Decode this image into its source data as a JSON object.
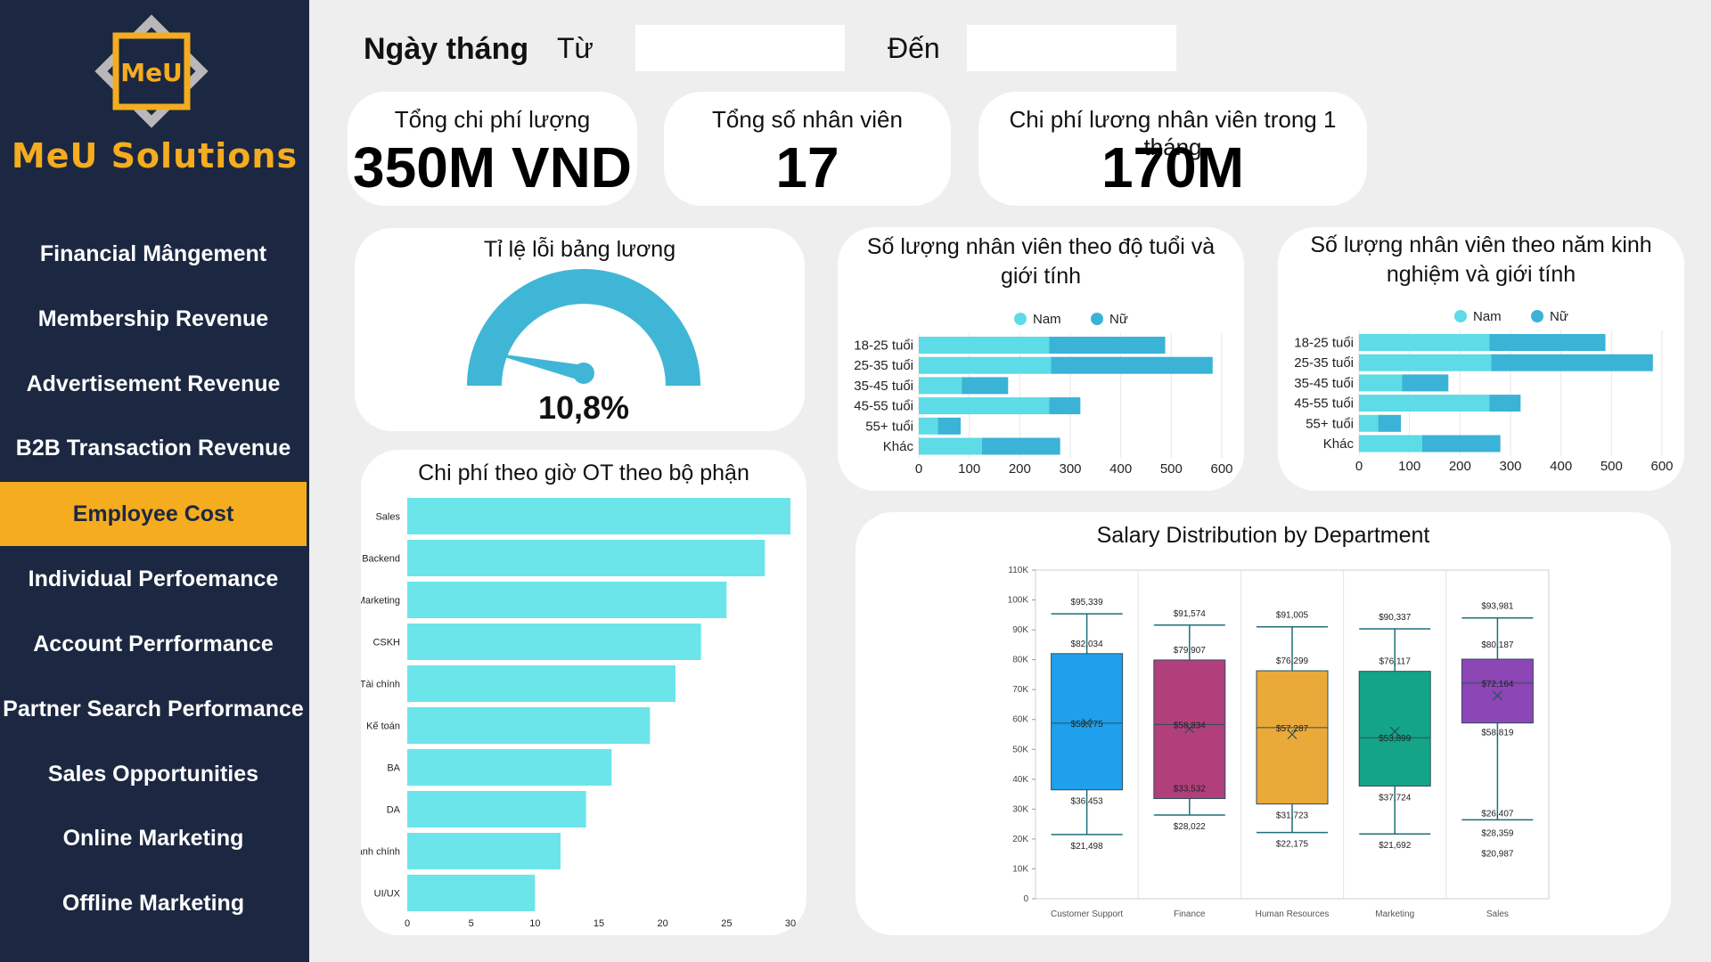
{
  "brand": {
    "logo_text": "MeU",
    "name": "MeU Solutions"
  },
  "nav": [
    {
      "label": "Financial Mângement"
    },
    {
      "label": "Membership Revenue"
    },
    {
      "label": "Advertisement Revenue"
    },
    {
      "label": "B2B Transaction Revenue"
    },
    {
      "label": "Employee Cost"
    },
    {
      "label": "Individual Perfoemance"
    },
    {
      "label": "Account Perrformance"
    },
    {
      "label": "Partner Search Performance"
    },
    {
      "label": "Sales Opportunities"
    },
    {
      "label": "Online Marketing"
    },
    {
      "label": "Offline Marketing"
    }
  ],
  "active_nav": "Employee Cost",
  "colors": {
    "sidebar": "#1c2841",
    "accent": "#f5ac1f",
    "nam": "#5ddbe6",
    "nu": "#3ab3d7",
    "ot_bar": "#6ce5ea",
    "gauge": "#40b6d6"
  },
  "date_filter": {
    "title": "Ngày tháng",
    "from_label": "Từ",
    "from_value": "",
    "to_label": "Đến",
    "to_value": ""
  },
  "kpis": [
    {
      "title": "Tổng chi phí lượng",
      "value": "350M VND"
    },
    {
      "title": "Tổng số nhân viên",
      "value": "17"
    },
    {
      "title": "Chi phí lương nhân viên trong 1 tháng",
      "value": "170M"
    }
  ],
  "gauge": {
    "title": "Tỉ lệ lỗi bảng lương",
    "value_label": "10,8%",
    "value": 0.108
  },
  "chart_data": [
    {
      "type": "bar",
      "orientation": "horizontal",
      "title": "Chi phí theo giờ OT theo bộ phận",
      "categories": [
        "Sales",
        "Backend",
        "Marketing",
        "CSKH",
        "Tài chính",
        "Kế toán",
        "BA",
        "DA",
        "Hành chính",
        "UI/UX"
      ],
      "values": [
        30,
        28,
        25,
        23,
        21,
        19,
        16,
        14,
        12,
        10
      ],
      "xlim": [
        0,
        30
      ],
      "xticks": [
        0,
        5,
        10,
        15,
        20,
        25,
        30
      ]
    },
    {
      "type": "bar",
      "orientation": "horizontal",
      "stacked": true,
      "title": "Số lượng nhân viên theo độ tuổi và giới tính",
      "categories": [
        "18-25 tuổi",
        "25-35 tuổi",
        "35-45 tuổi",
        "45-55 tuổi",
        "55+ tuổi",
        "Khác"
      ],
      "series": [
        {
          "name": "Nam",
          "values": [
            258,
            262,
            85,
            258,
            38,
            125
          ]
        },
        {
          "name": "Nữ",
          "values": [
            230,
            320,
            92,
            62,
            45,
            155
          ]
        }
      ],
      "xlim": [
        0,
        600
      ],
      "xticks": [
        0,
        100,
        200,
        300,
        400,
        500,
        600
      ],
      "legend": "top"
    },
    {
      "type": "bar",
      "orientation": "horizontal",
      "stacked": true,
      "title": "Số lượng nhân viên theo năm kinh nghiệm và giới tính",
      "categories": [
        "18-25 tuổi",
        "25-35 tuổi",
        "35-45 tuổi",
        "45-55 tuổi",
        "55+ tuổi",
        "Khác"
      ],
      "series": [
        {
          "name": "Nam",
          "values": [
            258,
            262,
            85,
            258,
            38,
            125
          ]
        },
        {
          "name": "Nữ",
          "values": [
            230,
            320,
            92,
            62,
            45,
            155
          ]
        }
      ],
      "xlim": [
        0,
        600
      ],
      "xticks": [
        0,
        100,
        200,
        300,
        400,
        500,
        600
      ],
      "legend": "top"
    },
    {
      "type": "box",
      "title": "Salary Distribution by Department",
      "categories": [
        "Customer Support",
        "Finance",
        "Human Resources",
        "Marketing",
        "Sales"
      ],
      "ylim": [
        0,
        110000
      ],
      "yticks": [
        "0",
        "10K",
        "20K",
        "30K",
        "40K",
        "50K",
        "60K",
        "70K",
        "80K",
        "90K",
        "100K",
        "110K"
      ],
      "boxes": [
        {
          "min": 21498,
          "q1": 36453,
          "median": 58775,
          "mean": 58775,
          "q3": 82034,
          "max": 95339,
          "color": "#1ea0ec",
          "labels": {
            "max": "$95,339",
            "q3": "$82,034",
            "median": "$58,775",
            "q1": "$36,453",
            "min": "$21,498"
          }
        },
        {
          "min": 28022,
          "q1": 33532,
          "median": 58334,
          "mean": 57000,
          "q3": 79907,
          "max": 91574,
          "color": "#b13f7b",
          "labels": {
            "max": "$91,574",
            "q3": "$79,907",
            "median": "$58,334",
            "q1": "$33,532",
            "min": "$28,022"
          }
        },
        {
          "min": 22175,
          "q1": 31723,
          "median": 57287,
          "mean": 55000,
          "q3": 76299,
          "max": 91005,
          "color": "#eaaa39",
          "labels": {
            "max": "$91,005",
            "q3": "$76,299",
            "median": "$57,287",
            "q1": "$31,723",
            "min": "$22,175"
          }
        },
        {
          "min": 21692,
          "q1": 37724,
          "median": 53899,
          "mean": 56000,
          "q3": 76117,
          "max": 90337,
          "color": "#14a487",
          "labels": {
            "max": "$90,337",
            "q3": "$76,117",
            "median": "$53,899",
            "q1": "$37,724",
            "min": "$21,692"
          }
        },
        {
          "min": 26407,
          "q1": 58819,
          "median": 72164,
          "mean": 68000,
          "q3": 80187,
          "max": 93981,
          "color": "#8c46b6",
          "labels": {
            "max": "$93,981",
            "q3": "$80,187",
            "median": "$72,164",
            "q1": "$58,819",
            "min": "$26,407",
            "extra": "$28,359",
            "extra2": "$20,987"
          }
        }
      ]
    }
  ]
}
